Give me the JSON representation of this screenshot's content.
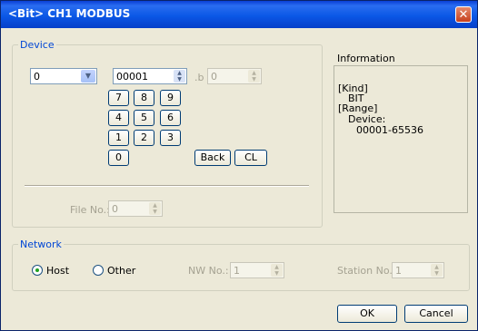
{
  "window": {
    "title": "<Bit> CH1 MODBUS",
    "close_symbol": "✕"
  },
  "device": {
    "group_label": "Device",
    "type_value": "0",
    "address_value": "00001",
    "bit_separator": ".b",
    "bit_value": "0",
    "keypad": [
      "7",
      "8",
      "9",
      "4",
      "5",
      "6",
      "1",
      "2",
      "3",
      "0"
    ],
    "back_label": "Back",
    "clear_label": "CL",
    "file_no_label": "File No.:",
    "file_no_value": "0"
  },
  "information": {
    "label": "Information",
    "lines": [
      "[Kind]",
      "BIT",
      "[Range]",
      "Device:",
      "00001-65536"
    ]
  },
  "network": {
    "group_label": "Network",
    "host_label": "Host",
    "other_label": "Other",
    "selected": "Host",
    "nw_no_label": "NW No.:",
    "nw_no_value": "1",
    "station_no_label": "Station No.:",
    "station_no_value": "1"
  },
  "buttons": {
    "ok": "OK",
    "cancel": "Cancel"
  }
}
